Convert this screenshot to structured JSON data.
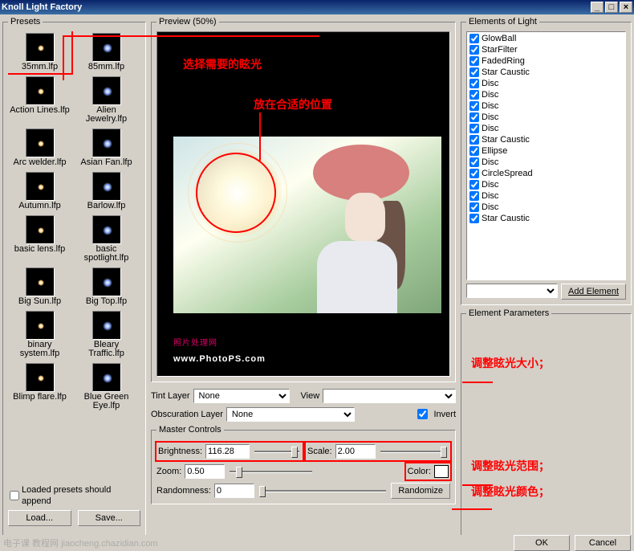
{
  "window_title": "Knoll Light Factory",
  "titlebar": {
    "min": "_",
    "max": "□",
    "close": "×"
  },
  "panels": {
    "presets": "Presets",
    "preview": "Preview (50%)",
    "elements_of_light": "Elements of Light",
    "element_parameters": "Element Parameters",
    "master_controls": "Master Controls"
  },
  "presets": [
    {
      "name": "35mm.lfp",
      "selected": true
    },
    {
      "name": "85mm.lfp"
    },
    {
      "name": "Action Lines.lfp"
    },
    {
      "name": "Alien Jewelry.lfp"
    },
    {
      "name": "Arc welder.lfp"
    },
    {
      "name": "Asian Fan.lfp"
    },
    {
      "name": "Autumn.lfp"
    },
    {
      "name": "Barlow.lfp"
    },
    {
      "name": "basic lens.lfp"
    },
    {
      "name": "basic spotlight.lfp"
    },
    {
      "name": "Big Sun.lfp"
    },
    {
      "name": "Big Top.lfp"
    },
    {
      "name": "binary system.lfp"
    },
    {
      "name": "Bleary Traffic.lfp"
    },
    {
      "name": "Blimp flare.lfp"
    },
    {
      "name": "Blue Green Eye.lfp"
    }
  ],
  "loaded_append_label": "Loaded presets should append",
  "load_btn": "Load...",
  "save_btn": "Save...",
  "annotations": {
    "choose": "选择需要的眩光",
    "position": "放在合适的位置",
    "size": "调整眩光大小；",
    "range": "调整眩光范围；",
    "color": "调整眩光颜色；"
  },
  "watermark": {
    "top": "照片处理网",
    "main_a": "www.",
    "main_b": "Photo",
    "main_c": "PS",
    "main_d": ".com"
  },
  "tint_layer": {
    "label": "Tint Layer",
    "value": "None"
  },
  "view": {
    "label": "View",
    "value": ""
  },
  "obscuration": {
    "label": "Obscuration Layer",
    "value": "None"
  },
  "invert": {
    "label": "Invert",
    "checked": true
  },
  "brightness": {
    "label": "Brightness:",
    "value": "116.28"
  },
  "scale": {
    "label": "Scale:",
    "value": "2.00"
  },
  "zoom": {
    "label": "Zoom:",
    "value": "0.50"
  },
  "color_lbl": "Color:",
  "randomness": {
    "label": "Randomness:",
    "value": "0"
  },
  "randomize": "Randomize",
  "elements": [
    {
      "label": "GlowBall"
    },
    {
      "label": "StarFilter"
    },
    {
      "label": "FadedRing"
    },
    {
      "label": "Star Caustic"
    },
    {
      "label": "Disc"
    },
    {
      "label": "Disc"
    },
    {
      "label": "Disc"
    },
    {
      "label": "Disc"
    },
    {
      "label": "Disc"
    },
    {
      "label": "Star Caustic"
    },
    {
      "label": "Ellipse"
    },
    {
      "label": "Disc"
    },
    {
      "label": "CircleSpread"
    },
    {
      "label": "Disc"
    },
    {
      "label": "Disc"
    },
    {
      "label": "Disc"
    },
    {
      "label": "Star Caustic"
    }
  ],
  "add_element": "Add Element",
  "ok": "OK",
  "cancel": "Cancel",
  "footer_watermark": "电子课 教程网  jiaocheng.chazidian.com"
}
